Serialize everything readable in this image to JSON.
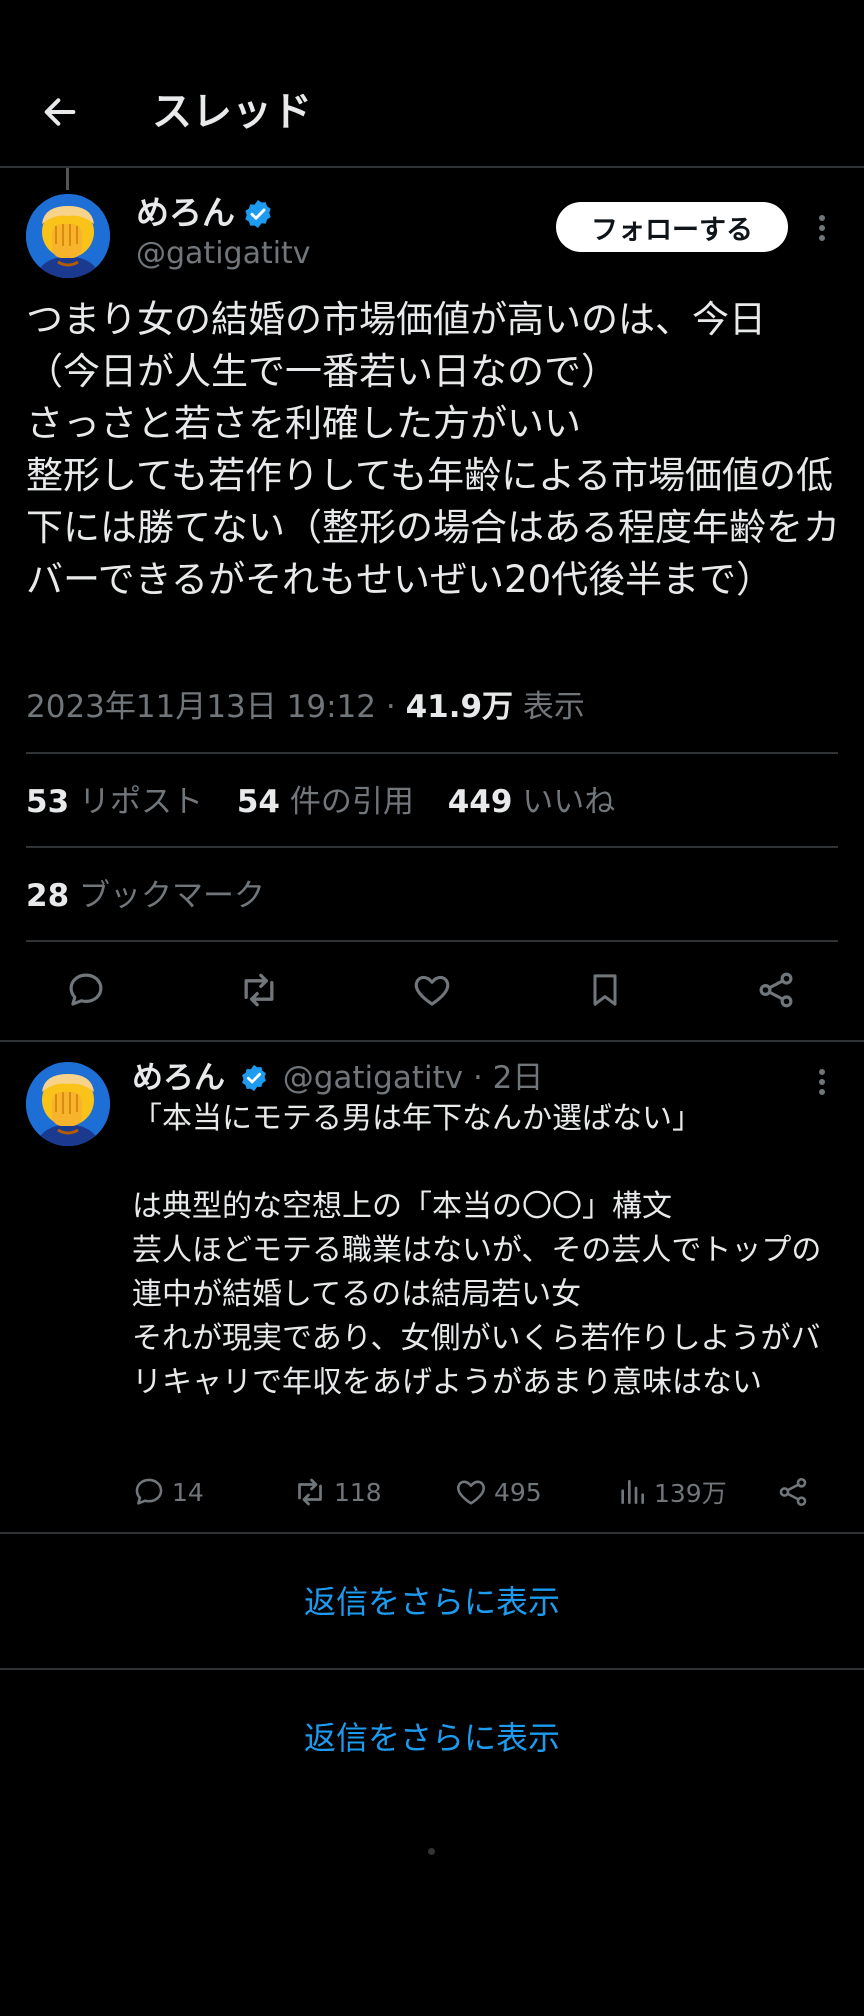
{
  "header": {
    "title": "スレッド"
  },
  "tweet": {
    "author": {
      "name": "めろん",
      "handle": "@gatigatitv"
    },
    "follow_label": "フォローする",
    "text": "つまり女の結婚の市場価値が高いのは、今日\n（今日が人生で一番若い日なので）\nさっさと若さを利確した方がいい\n整形しても若作りしても年齢による市場価値の低下には勝てない（整形の場合はある程度年齢をカバーできるがそれもせいぜい20代後半まで）",
    "timestamp": "2023年11月13日 19:12",
    "separator": "·",
    "views_count": "41.9万",
    "views_label": "表示",
    "reposts_count": "53",
    "reposts_label": "リポスト",
    "quotes_count": "54",
    "quotes_label": "件の引用",
    "likes_count": "449",
    "likes_label": "いいね",
    "bookmarks_count": "28",
    "bookmarks_label": "ブックマーク"
  },
  "reply": {
    "author": {
      "name": "めろん",
      "handle": "@gatigatitv",
      "time": "· 2日"
    },
    "text": "「本当にモテる男は年下なんか選ばない」\n\nは典型的な空想上の「本当の〇〇」構文\n芸人ほどモテる職業はないが、その芸人でトップの連中が結婚してるのは結局若い女\nそれが現実であり、女側がいくら若作りしようがバリキャリで年収をあげようがあまり意味はない",
    "replies": "14",
    "reposts": "118",
    "likes": "495",
    "views": "139万"
  },
  "show_more": [
    "返信をさらに表示",
    "返信をさらに表示"
  ],
  "colors": {
    "background": "#000000",
    "accent": "#1d9bf0",
    "verified": "#1d9bf0",
    "muted": "#71767b",
    "divider": "#2f3336"
  }
}
